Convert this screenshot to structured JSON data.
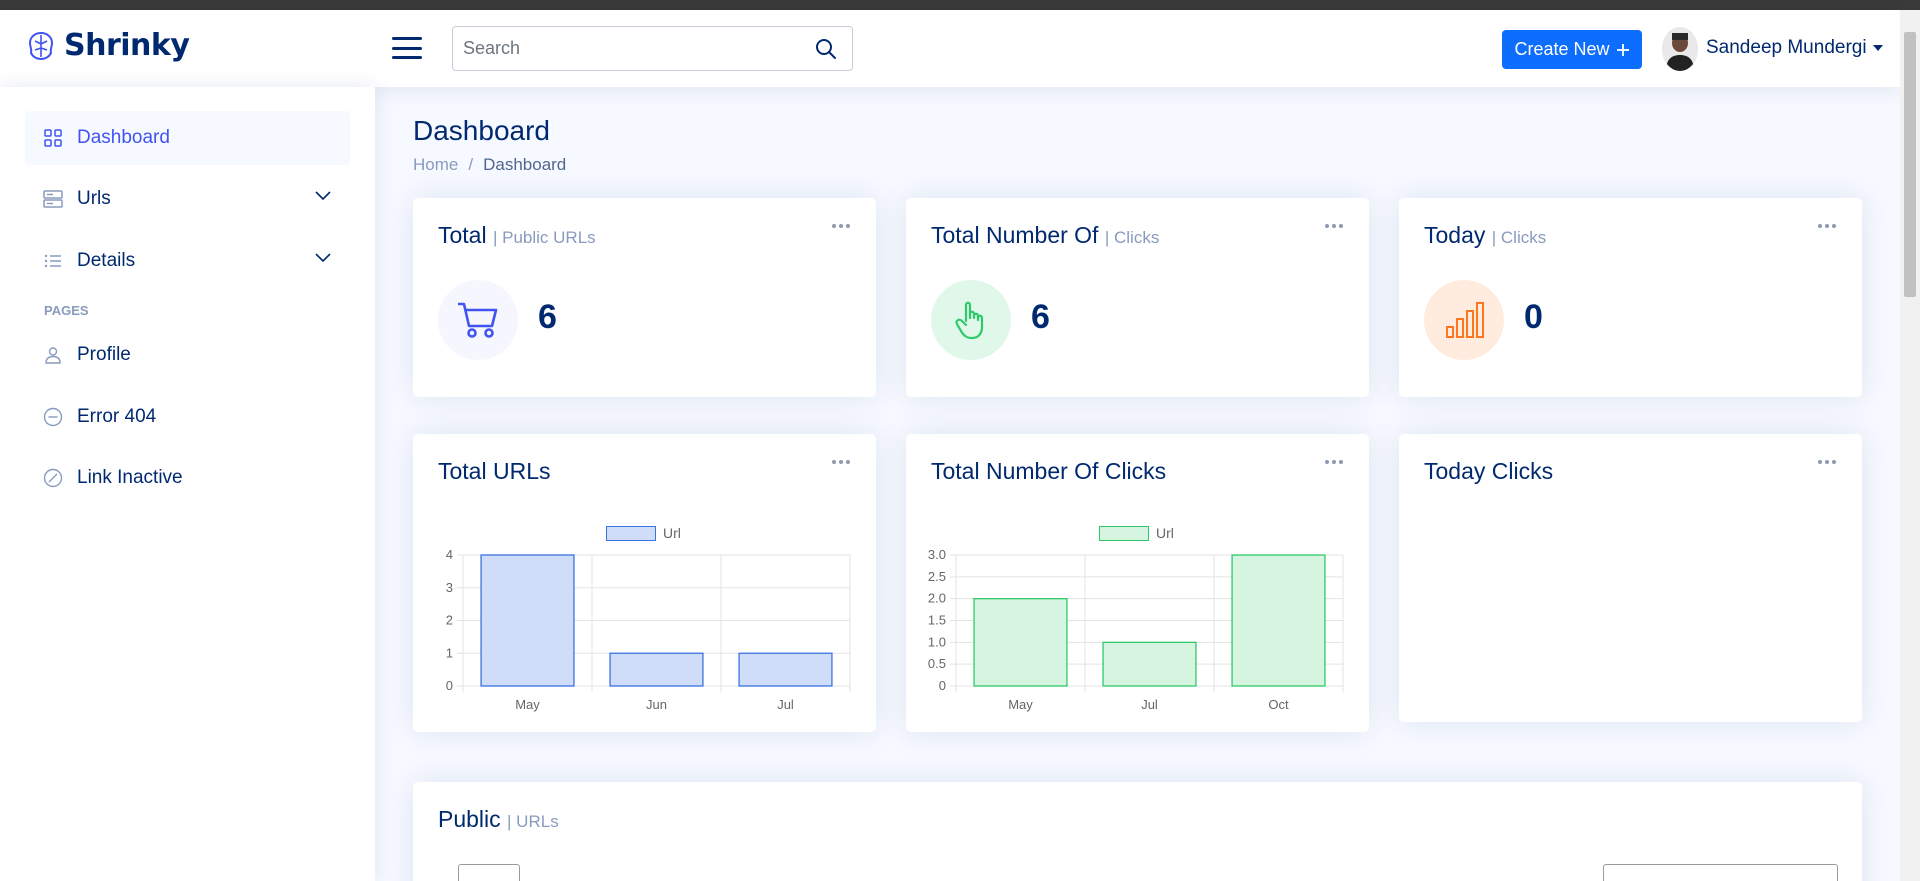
{
  "app": {
    "name": "Shrinky"
  },
  "header": {
    "search_placeholder": "Search",
    "create_label": "Create New",
    "create_icon": "plus-icon",
    "user_name": "Sandeep Mundergi"
  },
  "sidebar": {
    "items": [
      {
        "label": "Dashboard",
        "icon": "grid-icon",
        "active": true
      },
      {
        "label": "Urls",
        "icon": "server-icon",
        "expandable": true
      },
      {
        "label": "Details",
        "icon": "list-icon",
        "expandable": true
      }
    ],
    "pages_heading": "PAGES",
    "pages": [
      {
        "label": "Profile",
        "icon": "person-icon"
      },
      {
        "label": "Error 404",
        "icon": "dash-circle-icon"
      },
      {
        "label": "Link Inactive",
        "icon": "slash-circle-icon"
      }
    ]
  },
  "page": {
    "title": "Dashboard",
    "breadcrumb": [
      "Home",
      "/",
      "Dashboard"
    ]
  },
  "stats": [
    {
      "title": "Total",
      "subtitle": "| Public URLs",
      "value": "6",
      "icon": "cart-icon",
      "icon_color": "#4154f1",
      "icon_bg": "#f6f6fe"
    },
    {
      "title": "Total Number Of",
      "subtitle": "| Clicks",
      "value": "6",
      "icon": "hand-pointer-icon",
      "icon_color": "#2eca6a",
      "icon_bg": "#e0f8e9"
    },
    {
      "title": "Today",
      "subtitle": "| Clicks",
      "value": "0",
      "icon": "bar-chart-icon",
      "icon_color": "#ff771d",
      "icon_bg": "#ffecdf"
    }
  ],
  "charts_titles": [
    "Total URLs",
    "Total Number Of Clicks",
    "Today Clicks"
  ],
  "chart_data": [
    {
      "type": "bar",
      "title": "Total URLs",
      "categories": [
        "May",
        "Jun",
        "Jul"
      ],
      "series": [
        {
          "name": "Url",
          "values": [
            4,
            1,
            1
          ]
        }
      ],
      "ylim": [
        0,
        4
      ],
      "yticks": [
        "0",
        "1",
        "2",
        "3",
        "4"
      ],
      "color": "#3b73e0",
      "fill": "#cfddf8",
      "legend": "top-center",
      "grid": true
    },
    {
      "type": "bar",
      "title": "Total Number Of Clicks",
      "categories": [
        "May",
        "Jul",
        "Oct"
      ],
      "series": [
        {
          "name": "Url",
          "values": [
            2,
            1,
            3
          ]
        }
      ],
      "ylim": [
        0,
        3
      ],
      "yticks": [
        "0",
        "0.5",
        "1.0",
        "1.5",
        "2.0",
        "2.5",
        "3.0"
      ],
      "color": "#2eca6a",
      "fill": "#d5f5e0",
      "legend": "top-center",
      "grid": true
    }
  ],
  "public": {
    "title": "Public",
    "subtitle": "| URLs"
  }
}
